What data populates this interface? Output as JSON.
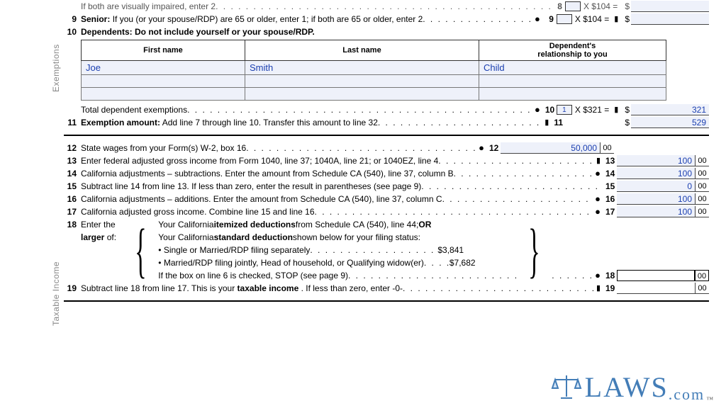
{
  "sections": {
    "exemptions_label": "Exemptions",
    "taxable_label": "Taxable Income"
  },
  "line8": {
    "partial_text": "If both are visually impaired, enter 2",
    "num": "8",
    "box_input": "",
    "mult": "X $104 =",
    "amount": ""
  },
  "line9": {
    "num": "9",
    "label": "Senior:",
    "text": "If you (or your spouse/RDP) are 65 or older, enter 1; if both are 65 or older, enter 2",
    "repeat_num": "9",
    "box_input": "",
    "mult": "X $104 =",
    "amount": ""
  },
  "line10": {
    "num": "10",
    "label": "Dependents: Do not include yourself or your spouse/RDP.",
    "headers": {
      "first": "First name",
      "last": "Last name",
      "rel": "Dependent's\nrelationship to you"
    },
    "rows": [
      {
        "first": "Joe",
        "last": "Smith",
        "rel": "Child"
      },
      {
        "first": "",
        "last": "",
        "rel": ""
      },
      {
        "first": "",
        "last": "",
        "rel": ""
      }
    ],
    "total_text": "Total dependent exemptions",
    "repeat_num": "10",
    "count_input": "1",
    "mult": "X $321 =",
    "amount": "321"
  },
  "line11": {
    "num": "11",
    "label": "Exemption amount:",
    "text": "Add line 7 through line 10. Transfer this amount to line 32",
    "repeat_num": "11",
    "amount": "529"
  },
  "line12": {
    "num": "12",
    "text": "State wages from your Form(s) W-2, box 16",
    "repeat_num": "12",
    "amount": "50,000",
    "cents": "00"
  },
  "line13": {
    "num": "13",
    "text": "Enter federal adjusted gross income from Form 1040, line 37; 1040A, line 21; or 1040EZ, line 4",
    "repeat_num": "13",
    "amount": "100",
    "cents": "00"
  },
  "line14": {
    "num": "14",
    "text": "California adjustments – subtractions. Enter the amount from Schedule CA (540), line 37, column B",
    "repeat_num": "14",
    "amount": "100",
    "cents": "00"
  },
  "line15": {
    "num": "15",
    "text": "Subtract line 14 from line 13. If less than zero, enter the result in parentheses (see page 9)",
    "repeat_num": "15",
    "amount": "0",
    "cents": "00"
  },
  "line16": {
    "num": "16",
    "text": "California adjustments – additions. Enter the amount from Schedule CA (540), line 37, column C",
    "repeat_num": "16",
    "amount": "100",
    "cents": "00"
  },
  "line17": {
    "num": "17",
    "text": "California adjusted gross income. Combine line 15 and line 16",
    "repeat_num": "17",
    "amount": "100",
    "cents": "00"
  },
  "line18": {
    "num": "18",
    "left1": "Enter the",
    "left2_pre": "larger",
    "left2_post": " of:",
    "a_pre": "Your California ",
    "a_b": "itemized deductions",
    "a_post": " from Schedule CA (540), line 44; ",
    "a_or": "OR",
    "b_pre": "Your California ",
    "b_b": "standard deduction",
    "b_post": " shown below for your filing status:",
    "c_text": "• Single or Married/RDP filing separately",
    "c_amt": "$3,841",
    "d_text": "• Married/RDP filing jointly, Head of household, or Qualifying widow(er)",
    "d_amt": "$7,682",
    "e_text": "If the box on line 6 is checked, STOP (see page 9)",
    "repeat_num": "18",
    "amount": "",
    "cents": "00"
  },
  "line19": {
    "num": "19",
    "pre": "Subtract line 18 from line 17. This is your ",
    "b": "taxable income",
    "post": ". If less than zero, enter -0-",
    "repeat_num": "19",
    "amount": "",
    "cents": "00"
  },
  "symbols": {
    "dollar": "$"
  },
  "watermark": {
    "text": "LAWS",
    "suffix": ".com",
    "tm": "™"
  }
}
